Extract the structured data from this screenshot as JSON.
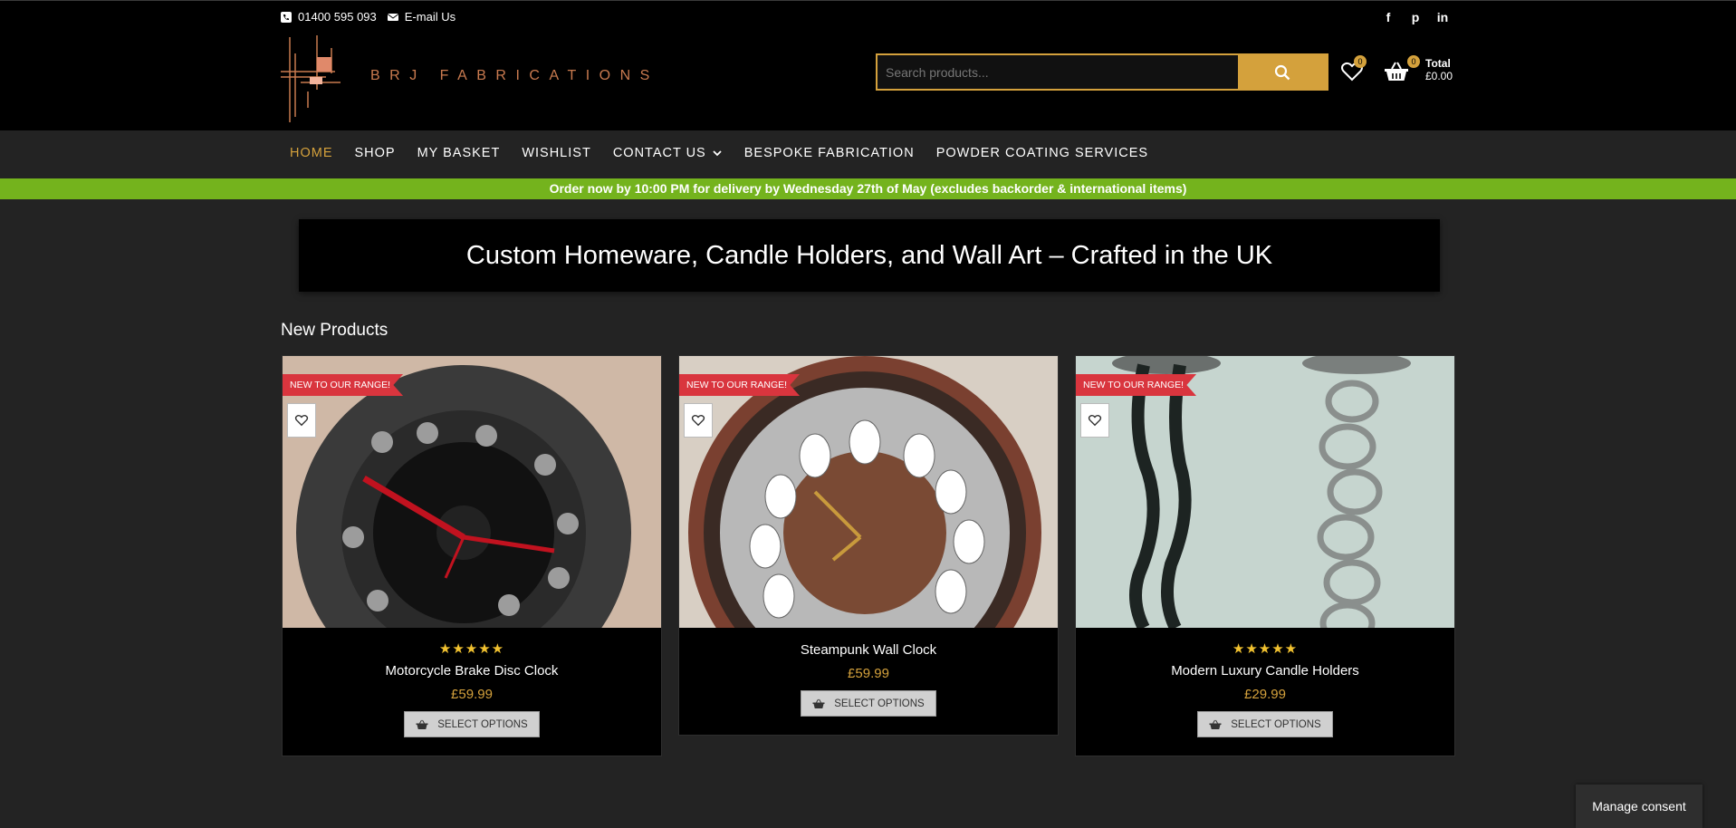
{
  "header": {
    "phone": "01400 595 093",
    "email_label": "E-mail Us",
    "logo_text": "BRJ FABRICATIONS",
    "search_placeholder": "Search products...",
    "wishlist_count": "0",
    "basket_count": "0",
    "total_label": "Total",
    "total_value": "£0.00",
    "social": [
      "facebook-icon",
      "pinterest-icon",
      "linkedin-icon"
    ]
  },
  "nav": {
    "items": [
      {
        "label": "HOME"
      },
      {
        "label": "SHOP"
      },
      {
        "label": "MY BASKET"
      },
      {
        "label": "WISHLIST"
      },
      {
        "label": "CONTACT US"
      },
      {
        "label": "BESPOKE FABRICATION"
      },
      {
        "label": "POWDER COATING SERVICES"
      }
    ]
  },
  "promo": "Order now by 10:00 PM for delivery by Wednesday 27th of May (excludes backorder & international items)",
  "banner": "Custom Homeware, Candle Holders, and Wall Art – Crafted in the UK",
  "section_title": "New Products",
  "products": [
    {
      "ribbon": "NEW TO OUR RANGE!",
      "stars": "★★★★★",
      "rating": 5,
      "name": "Motorcycle Brake Disc Clock",
      "price": "£59.99",
      "button": "SELECT OPTIONS"
    },
    {
      "ribbon": "NEW TO OUR RANGE!",
      "stars": "",
      "rating": 0,
      "name": "Steampunk Wall Clock",
      "price": "£59.99",
      "button": "SELECT OPTIONS"
    },
    {
      "ribbon": "NEW TO OUR RANGE!",
      "stars": "★★★★★",
      "rating": 5,
      "name": "Modern Luxury Candle Holders",
      "price": "£29.99",
      "button": "SELECT OPTIONS"
    }
  ],
  "consent": "Manage consent",
  "colors": {
    "accent": "#d4a13c",
    "promo": "#74b31d",
    "ribbon": "#d9353e"
  }
}
